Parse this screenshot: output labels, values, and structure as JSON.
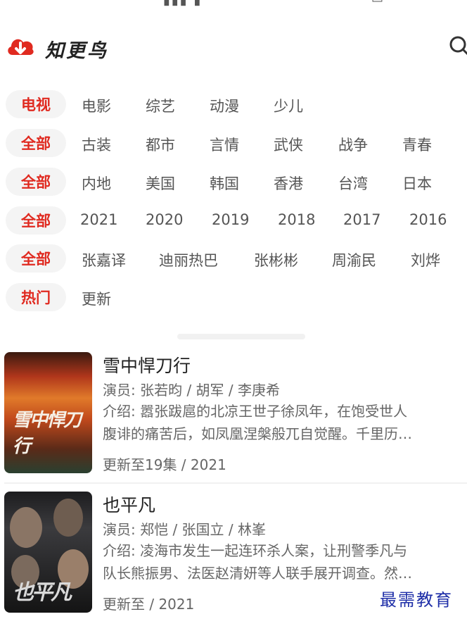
{
  "app": {
    "title": "知更鸟"
  },
  "filters": [
    {
      "chip": "电视",
      "options": [
        "电影",
        "综艺",
        "动漫",
        "少儿"
      ]
    },
    {
      "chip": "全部",
      "options": [
        "古装",
        "都市",
        "言情",
        "武侠",
        "战争",
        "青春"
      ]
    },
    {
      "chip": "全部",
      "options": [
        "内地",
        "美国",
        "韩国",
        "香港",
        "台湾",
        "日本"
      ]
    },
    {
      "chip": "全部",
      "options": [
        "2021",
        "2020",
        "2019",
        "2018",
        "2017",
        "2016"
      ]
    },
    {
      "chip": "全部",
      "options": [
        "张嘉译",
        "迪丽热巴",
        "张彬彬",
        "周渝民",
        "刘烨"
      ]
    },
    {
      "chip": "热门",
      "options": [
        "更新"
      ]
    }
  ],
  "shows": [
    {
      "title": "雪中悍刀行",
      "actors": "演员: 张若昀 / 胡军 / 李庚希",
      "desc1": "介绍: 嚣张跋扈的北凉王世子徐凤年，在饱受世人",
      "desc2": "腹诽的痛苦后，如凤凰涅槃般兀自觉醒。千里历…",
      "update": "更新至19集 / 2021",
      "poster_text": "雪中悍刀行"
    },
    {
      "title": "也平凡",
      "actors": "演员: 郑恺 / 张国立 / 林峯",
      "desc1": "介绍: 凌海市发生一起连环杀人案，让刑警季凡与",
      "desc2": "队长熊振男、法医赵清妍等人联手展开调查。然…",
      "update": "更新至 / 2021",
      "poster_text": "也平凡"
    }
  ],
  "watermark": "最需教育",
  "colors": {
    "accent": "#e02a20"
  }
}
